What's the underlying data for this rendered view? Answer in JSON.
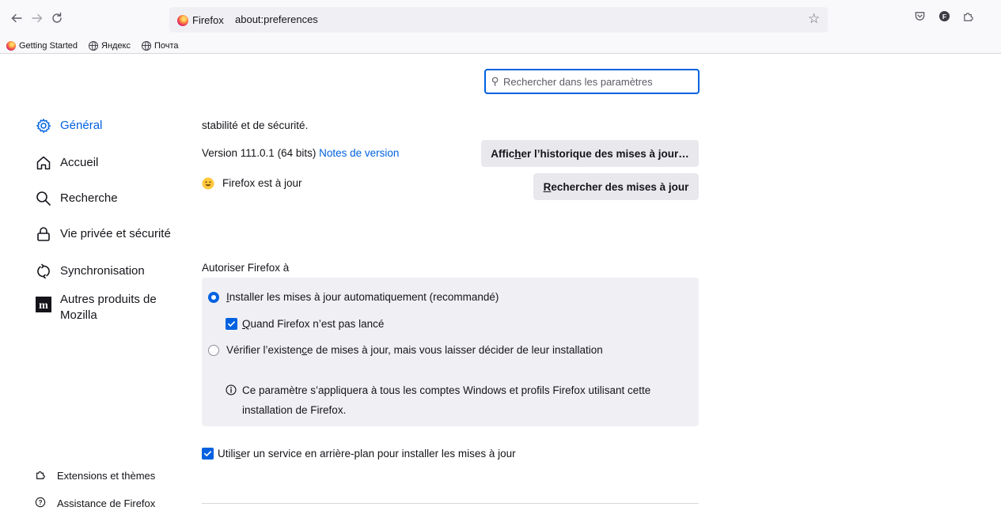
{
  "browser": {
    "identity_label": "Firefox",
    "url": "about:preferences"
  },
  "bookmarks": [
    {
      "label": "Getting Started"
    },
    {
      "label": "Яндекс"
    },
    {
      "label": "Почта"
    }
  ],
  "search": {
    "placeholder": "Rechercher dans les paramètres"
  },
  "sidebar": {
    "categories": [
      {
        "label": "Général",
        "icon": "gear-icon",
        "selected": true
      },
      {
        "label": "Accueil",
        "icon": "home-icon"
      },
      {
        "label": "Recherche",
        "icon": "search-icon"
      },
      {
        "label": "Vie privée et sécurité",
        "icon": "lock-icon"
      },
      {
        "label": "Synchronisation",
        "icon": "sync-icon"
      },
      {
        "label_line1": "Autres produits de",
        "label_line2": "Mozilla",
        "icon": "mozilla-icon"
      }
    ],
    "footer": [
      {
        "label": "Extensions et thèmes",
        "icon": "puzzle-icon"
      },
      {
        "label": "Assistance de Firefox",
        "icon": "help-icon"
      }
    ]
  },
  "updates": {
    "partial_text": "stabilité et de sécurité.",
    "version_text": "Version 111.0.1 (64 bits)",
    "release_notes_link": "Notes de version",
    "history_button_pre": "Affic",
    "history_button_key": "h",
    "history_button_post": "er l’historique des mises à jour…",
    "status_text": "Firefox est à jour",
    "check_button_key": "R",
    "check_button_post": "echercher des mises à jour",
    "allow_heading": "Autoriser Firefox à",
    "auto_install_key": "I",
    "auto_install_post": "nstaller les mises à jour automatiquement (recommandé)",
    "when_not_running_key": "Q",
    "when_not_running_post": "uand Firefox n’est pas lancé",
    "check_only_pre": "Vérifier l’existen",
    "check_only_key": "c",
    "check_only_post": "e de mises à jour, mais vous laisser décider de leur installation",
    "info_line1": "Ce paramètre s’appliquera à tous les comptes Windows et profils Firefox utilisant cette",
    "info_line2": "installation de Firefox.",
    "background_pre": "Utili",
    "background_key": "s",
    "background_post": "er un service en arrière-plan pour installer les mises à jour"
  },
  "colors": {
    "accent": "#0061e0",
    "button_bg": "#e9e9ed",
    "box_bg": "#f0f0f4"
  }
}
